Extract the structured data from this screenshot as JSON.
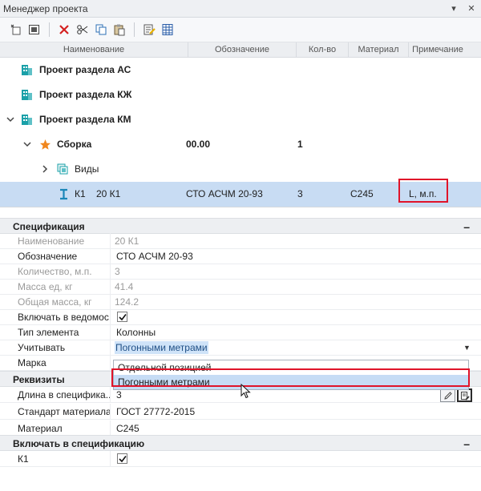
{
  "window": {
    "title": "Менеджер проекта",
    "controls": [
      "▾",
      "✕"
    ]
  },
  "grid": {
    "columns": [
      "Наименование",
      "Обозначение",
      "Кол-во",
      "Материал",
      "Примечание"
    ]
  },
  "tree": {
    "rows": [
      {
        "label": "Проект раздела АС"
      },
      {
        "label": "Проект раздела КЖ"
      },
      {
        "label": "Проект раздела КМ"
      },
      {
        "label": "Сборка",
        "designation": "00.00",
        "qty": "1"
      },
      {
        "label": "Виды"
      },
      {
        "mark": "К1",
        "label": "20 К1",
        "designation": "СТО АСЧМ 20-93",
        "qty": "3",
        "material": "С245",
        "note": "L, м.п."
      }
    ]
  },
  "spec": {
    "title": "Спецификация",
    "collapse": "–",
    "props": [
      {
        "name": "Наименование",
        "value": "20 К1"
      },
      {
        "name": "Обозначение",
        "value": "СТО АСЧМ 20-93"
      },
      {
        "name": "Количество, м.п.",
        "value": "3"
      },
      {
        "name": "Масса ед, кг",
        "value": "41.4"
      },
      {
        "name": "Общая масса, кг",
        "value": "124.2"
      },
      {
        "name": "Включать в ведомос...",
        "value": ""
      },
      {
        "name": "Тип элемента",
        "value": "Колонны"
      },
      {
        "name": "Учитывать",
        "value": "Погонными метрами"
      },
      {
        "name": "Марка",
        "value": ""
      }
    ]
  },
  "dropdown": {
    "options": [
      "Отдельной позицией",
      "Погонными метрами"
    ]
  },
  "requisites": {
    "title": "Реквизиты",
    "props": [
      {
        "name": "Длина в специфика...",
        "value": "3"
      },
      {
        "name": "Стандарт материала",
        "value": "ГОСТ 27772-2015"
      },
      {
        "name": "Материал",
        "value": "С245"
      }
    ]
  },
  "include": {
    "title": "Включать в спецификацию",
    "collapse": "–",
    "props": [
      {
        "name": "К1",
        "value": ""
      }
    ]
  },
  "colors": {
    "selected_row": "#c8dcf3",
    "highlight": "#e0142a",
    "accent_icon": "#1aa0a8",
    "star": "#f0861e"
  }
}
